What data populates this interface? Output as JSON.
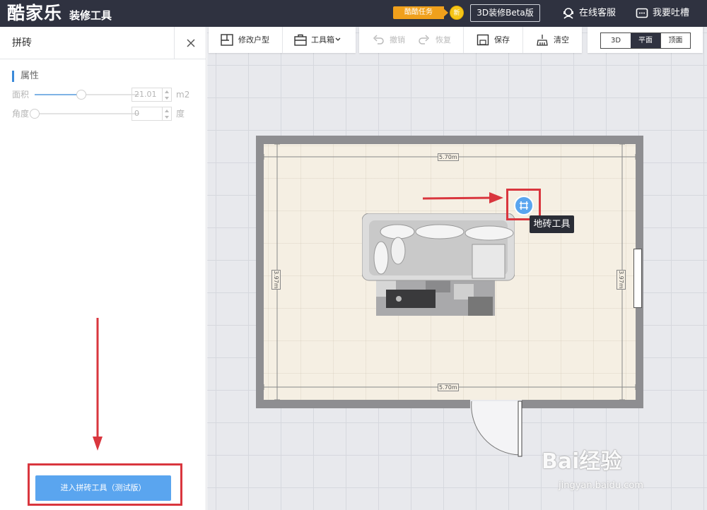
{
  "topbar": {
    "logo": "酷家乐",
    "logo_sub": "装修工具",
    "task_badge": "酷酷任务",
    "task_coin": "新",
    "beta_button": "3D装修Beta版",
    "online_service": "在线客服",
    "feedback": "我要吐槽"
  },
  "panel": {
    "title": "拼砖",
    "section": "属性",
    "area": {
      "label": "面积",
      "value": "21.01",
      "unit": "m2",
      "slider_fraction": 0.45
    },
    "angle": {
      "label": "角度",
      "value": "0",
      "unit": "度",
      "slider_fraction": 0.0
    },
    "enter_button": "进入拼砖工具（测试版）"
  },
  "toolbar": {
    "modify_layout": "修改户型",
    "toolbox": "工具箱",
    "undo": "撤销",
    "redo": "恢复",
    "save": "保存",
    "clear": "清空",
    "view_3d": "3D",
    "view_plan": "平面",
    "view_top": "顶面",
    "active_view": "平面"
  },
  "room": {
    "width_top": "5.70m",
    "width_bottom": "5.70m",
    "height_left": "3.97m",
    "height_right": "3.97m"
  },
  "tile_tool": {
    "tooltip": "地砖工具"
  },
  "watermark": {
    "brand": "Bai经验",
    "url": "jingyan.baidu.com"
  },
  "colors": {
    "topbar_bg": "#2f3240",
    "accent_blue": "#5aa5ef",
    "highlight_red": "#d9363e",
    "task_orange": "#f0a01c"
  }
}
